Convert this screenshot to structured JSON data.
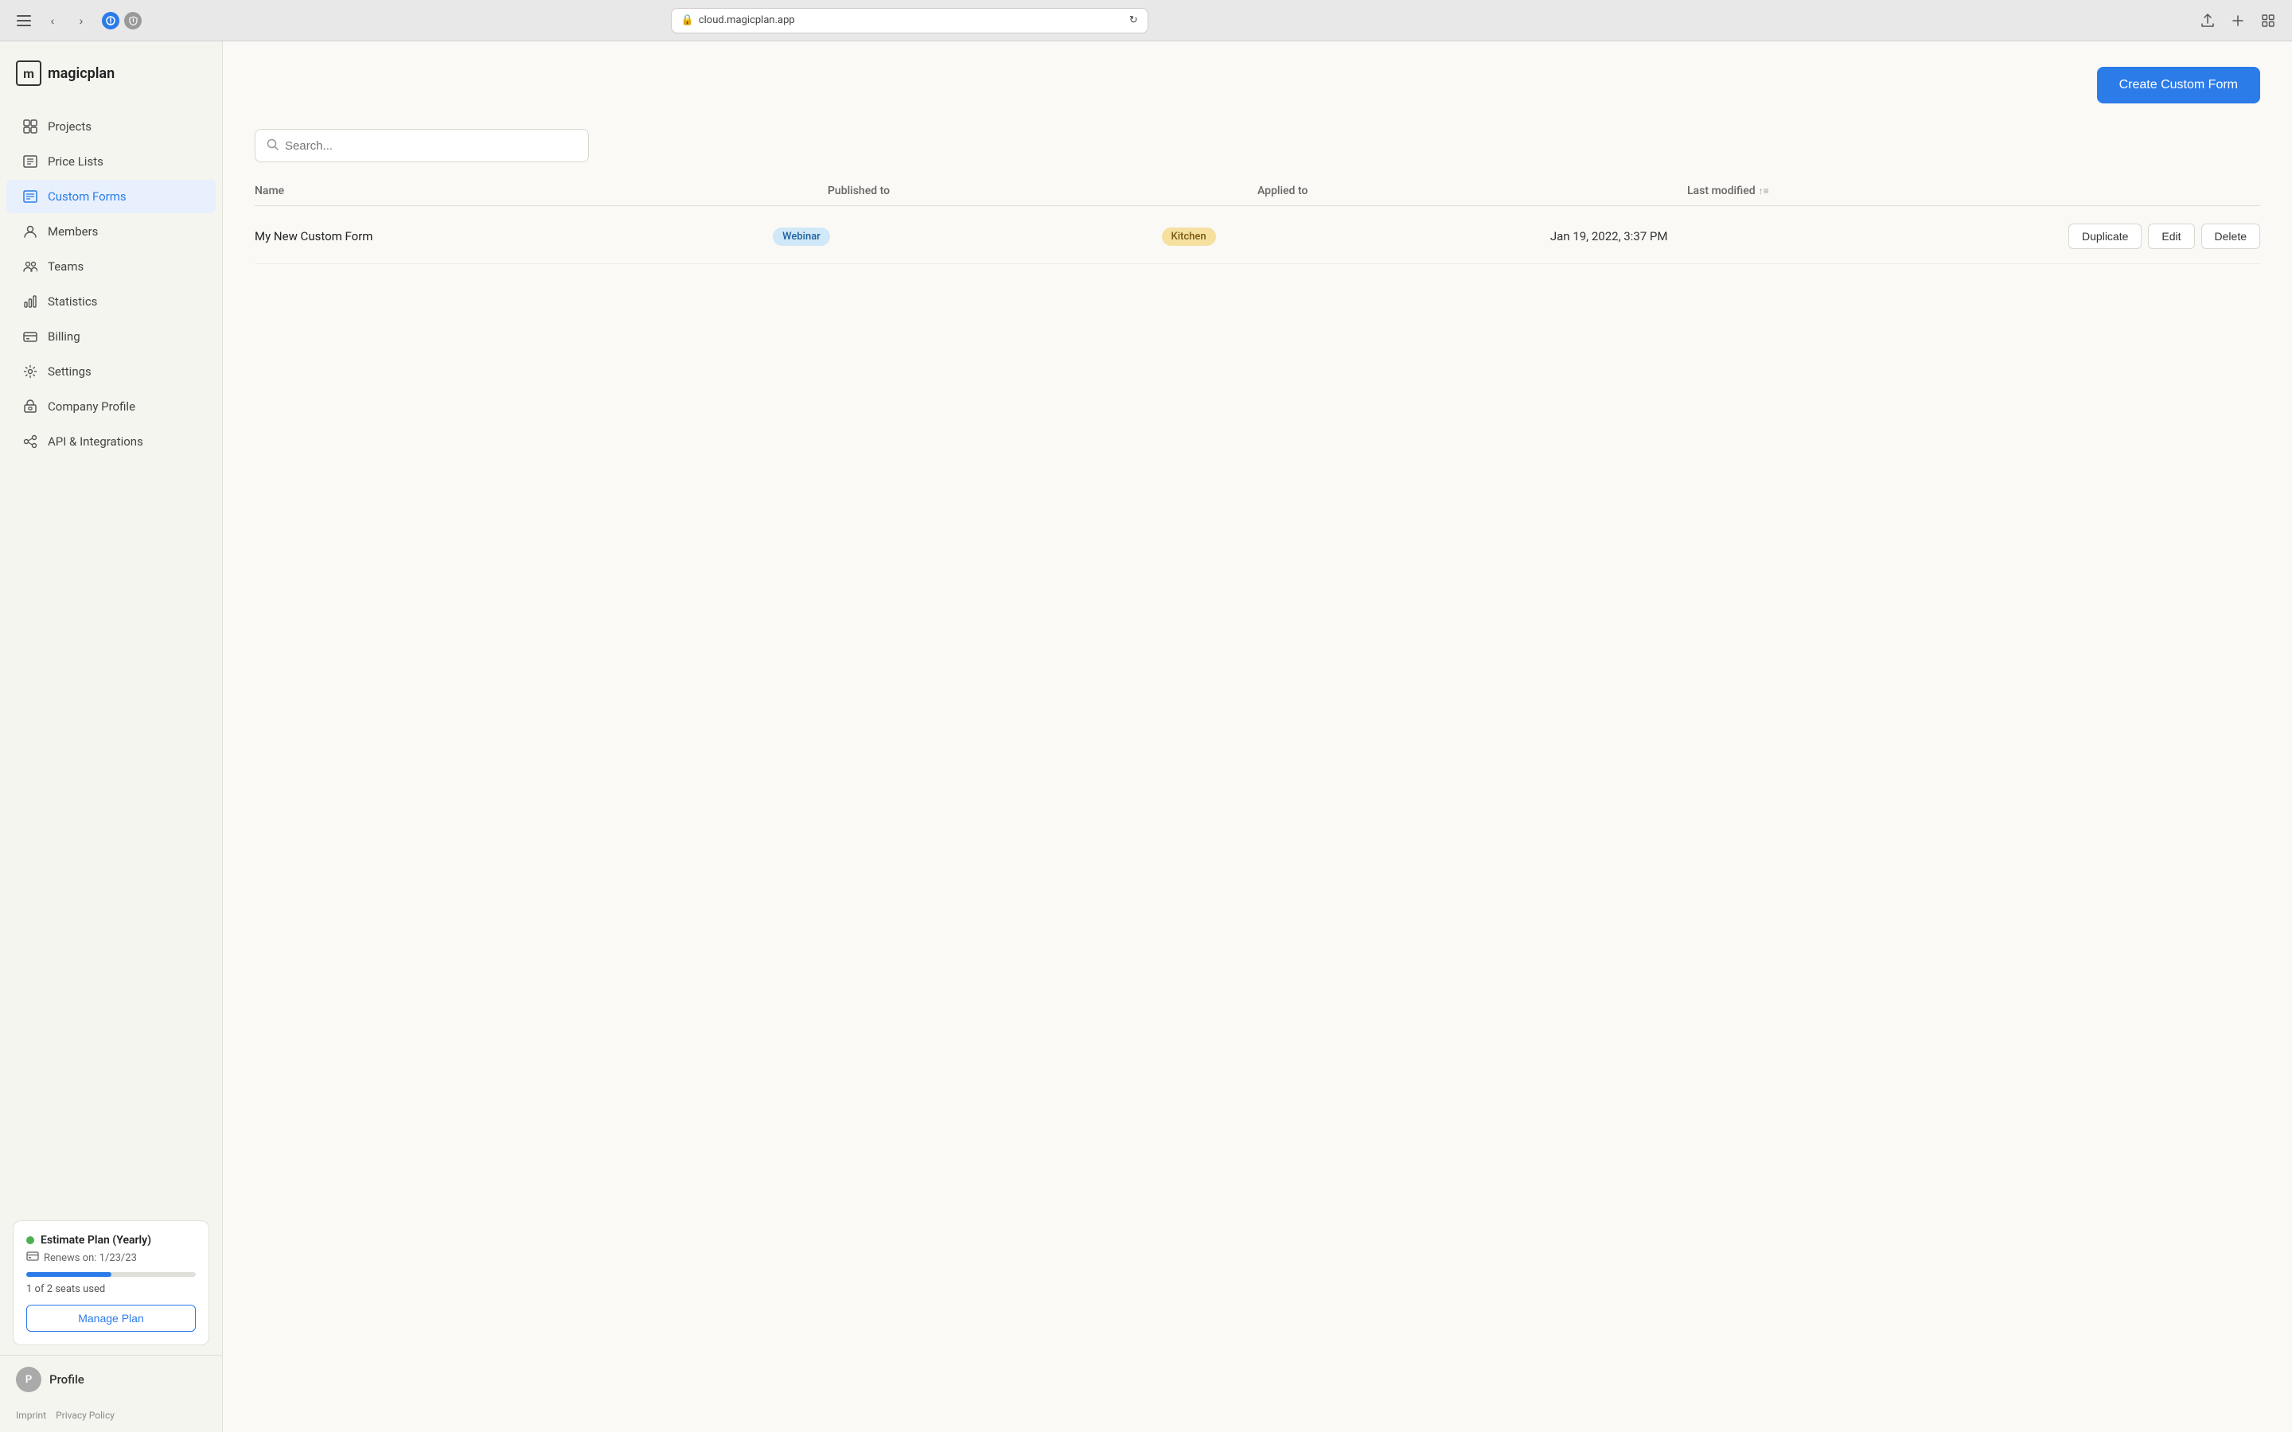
{
  "browser": {
    "url": "cloud.magicplan.app",
    "reload_icon": "↻"
  },
  "app": {
    "logo_letter": "m",
    "logo_brand": "magicplan"
  },
  "sidebar": {
    "nav_items": [
      {
        "id": "projects",
        "label": "Projects",
        "icon": "≡"
      },
      {
        "id": "price-lists",
        "label": "Price Lists",
        "icon": "▦"
      },
      {
        "id": "custom-forms",
        "label": "Custom Forms",
        "icon": "☷",
        "active": true
      },
      {
        "id": "members",
        "label": "Members",
        "icon": "👤"
      },
      {
        "id": "teams",
        "label": "Teams",
        "icon": "👥"
      },
      {
        "id": "statistics",
        "label": "Statistics",
        "icon": "📊"
      },
      {
        "id": "billing",
        "label": "Billing",
        "icon": "💳"
      },
      {
        "id": "settings",
        "label": "Settings",
        "icon": "⚙"
      },
      {
        "id": "company-profile",
        "label": "Company Profile",
        "icon": "🏢"
      },
      {
        "id": "api-integrations",
        "label": "API & Integrations",
        "icon": "🔗"
      }
    ],
    "plan": {
      "name": "Estimate Plan (Yearly)",
      "renews_label": "Renews on: 1/23/23",
      "seats_used": 1,
      "seats_total": 2,
      "seats_text": "1 of 2 seats used",
      "progress_pct": 50,
      "manage_label": "Manage Plan"
    },
    "profile": {
      "name": "Profile",
      "avatar_initials": "P"
    },
    "footer": {
      "imprint": "Imprint",
      "privacy": "Privacy Policy"
    }
  },
  "main": {
    "create_button_label": "Create Custom Form",
    "search_placeholder": "Search...",
    "table": {
      "headers": [
        {
          "id": "name",
          "label": "Name",
          "sortable": false
        },
        {
          "id": "published-to",
          "label": "Published to",
          "sortable": false
        },
        {
          "id": "applied-to",
          "label": "Applied to",
          "sortable": false
        },
        {
          "id": "last-modified",
          "label": "Last modified",
          "sortable": true
        },
        {
          "id": "actions",
          "label": ""
        }
      ],
      "rows": [
        {
          "name": "My New Custom Form",
          "published_to": "Webinar",
          "published_badge_type": "blue",
          "applied_to": "Kitchen",
          "applied_badge_type": "yellow",
          "last_modified": "Jan 19, 2022, 3:37 PM",
          "actions": [
            "Duplicate",
            "Edit",
            "Delete"
          ]
        }
      ]
    }
  }
}
